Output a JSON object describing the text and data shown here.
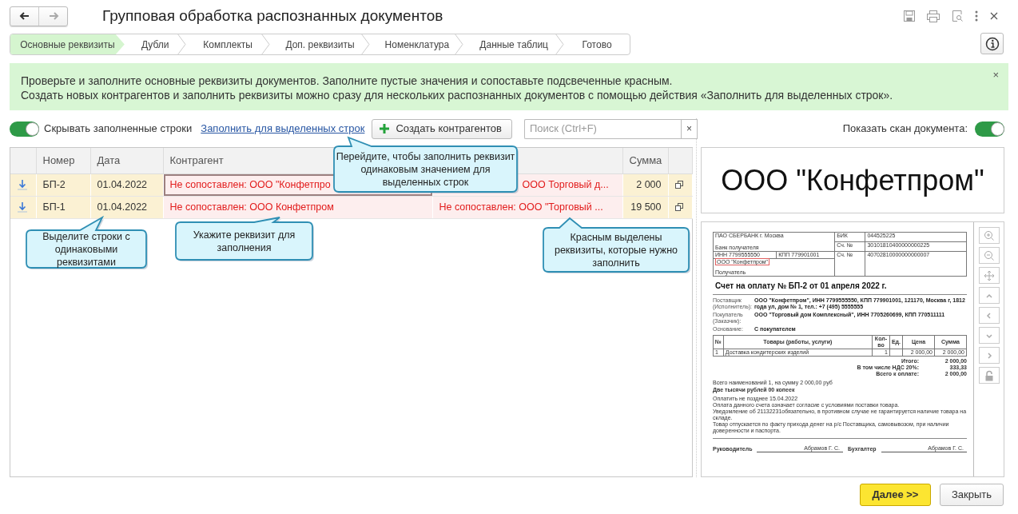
{
  "window": {
    "title": "Групповая обработка распознанных документов"
  },
  "nav": {
    "back": {
      "enabled": true
    },
    "forward": {
      "enabled": false
    }
  },
  "steps": [
    {
      "label": "Основные реквизиты",
      "selected": true
    },
    {
      "label": "Дубли",
      "selected": false
    },
    {
      "label": "Комплекты",
      "selected": false
    },
    {
      "label": "Доп. реквизиты",
      "selected": false
    },
    {
      "label": "Номенклатура",
      "selected": false
    },
    {
      "label": "Данные таблиц",
      "selected": false
    },
    {
      "label": "Готово",
      "selected": false
    }
  ],
  "info_banner": {
    "lines": [
      "Проверьте и заполните основные реквизиты документов. Заполните пустые значения и сопоставьте подсвеченные красным.",
      "Создать новых контрагентов и заполнить реквизиты можно сразу для нескольких распознанных документов с помощью действия «Заполнить для выделенных строк»."
    ],
    "close": "×"
  },
  "toolbar": {
    "hide_filled": {
      "label": "Скрывать заполненные строки",
      "on": true
    },
    "fill_link": "Заполнить для выделенных строк",
    "create_button": "Создать контрагентов",
    "search": {
      "placeholder": "Поиск (Ctrl+F)",
      "clear": "×"
    }
  },
  "show_scan": {
    "label": "Показать скан документа:",
    "on": true
  },
  "table": {
    "columns": [
      "Номер",
      "Дата",
      "Контрагент",
      "Сумма"
    ],
    "rows": [
      {
        "selected": true,
        "number": "БП-2",
        "date": "01.04.2022",
        "counterparty": {
          "text": "Не сопоставлен: ООО \"Конфетпро",
          "unmatched": true,
          "focused": true
        },
        "column_4": {
          "text": "ООО Торговый д...",
          "unmatched": true
        },
        "sum": "2 000"
      },
      {
        "selected": true,
        "number": "БП-1",
        "date": "01.04.2022",
        "counterparty": {
          "text": "Не сопоставлен: ООО Конфетпром",
          "unmatched": true,
          "focused": false
        },
        "column_4": {
          "text": "Не сопоставлен: ООО \"Торговый ...",
          "unmatched": true
        },
        "sum": "19 500"
      }
    ]
  },
  "callouts": [
    {
      "text": "Перейдите, чтобы заполнить реквизит одинаковым значением для выделенных строк"
    },
    {
      "text": "Выделите строки с одинаковыми реквизитами"
    },
    {
      "text": "Укажите реквизит для заполнения"
    },
    {
      "text": "Красным выделены реквизиты, которые нужно заполнить"
    }
  ],
  "scan": {
    "header_text": "ООО \"Конфетпром\"",
    "document": {
      "bank": {
        "bank_name": "ПАО СБЕРБАНК г. Москва",
        "bank_caption": "Банк получателя",
        "bik_label": "БИК",
        "bik": "044525225",
        "corr_label": "Сч. №",
        "corr": "30101810400000000225",
        "inn_label": "ИНН",
        "inn": "7799555550",
        "kpp_label": "КПП",
        "kpp": "779901001",
        "acct_label": "Сч. №",
        "acct": "40702810000000000007",
        "recipient": "ООО \"Конфетпром\"",
        "recipient_highlighted": true,
        "recipient_caption": "Получатель"
      },
      "title": "Счет на оплату № БП-2 от 01 апреля 2022 г.",
      "parties": [
        {
          "label": "Поставщик (Исполнитель):",
          "value": "ООО \"Конфетпром\", ИНН 7799555550, КПП 779901001, 121170, Москва г, 1812 года ул, дом № 1, тел.: +7 (495) 5555555"
        },
        {
          "label": "Покупатель (Заказчик):",
          "value": "ООО \"Торговый дом Комплексный\", ИНН 7705260699, КПП 770511111"
        },
        {
          "label": "Основание:",
          "value": "С покупателем"
        }
      ],
      "items": {
        "columns": [
          "№",
          "Товары (работы, услуги)",
          "Кол-во",
          "Ед.",
          "Цена",
          "Сумма"
        ],
        "rows": [
          {
            "n": "1",
            "name": "Доставка кондитерских изделий",
            "qty": "1",
            "price": "2 000,00",
            "sum": "2 000,00"
          }
        ]
      },
      "totals": [
        {
          "label": "Итого:",
          "value": "2 000,00"
        },
        {
          "label": "В том числе НДС 20%:",
          "value": "333,33"
        },
        {
          "label": "Всего к оплате:",
          "value": "2 000,00"
        }
      ],
      "summary": "Всего наименований 1, на сумму 2 000,00 руб",
      "amount_words": "Две тысячи рублей 00 копеек",
      "notes": [
        "Оплатить не позднее 15.04.2022",
        "Оплата данного счета означает согласие с условиями поставки товара.",
        "Уведомление об 21132231обязательно, в противном случае не гарантируется наличие товара на складе.",
        "Товар отпускается по факту прихода денег на р/с Поставщика, самовывозом, при наличии доверенности и паспорта."
      ],
      "signatures": [
        {
          "role": "Руководитель",
          "name": "Абрамов Г. С."
        },
        {
          "role": "Бухгалтер",
          "name": "Абрамов Г. С."
        }
      ]
    }
  },
  "buttons": {
    "next": "Далее >>",
    "close": "Закрыть"
  }
}
